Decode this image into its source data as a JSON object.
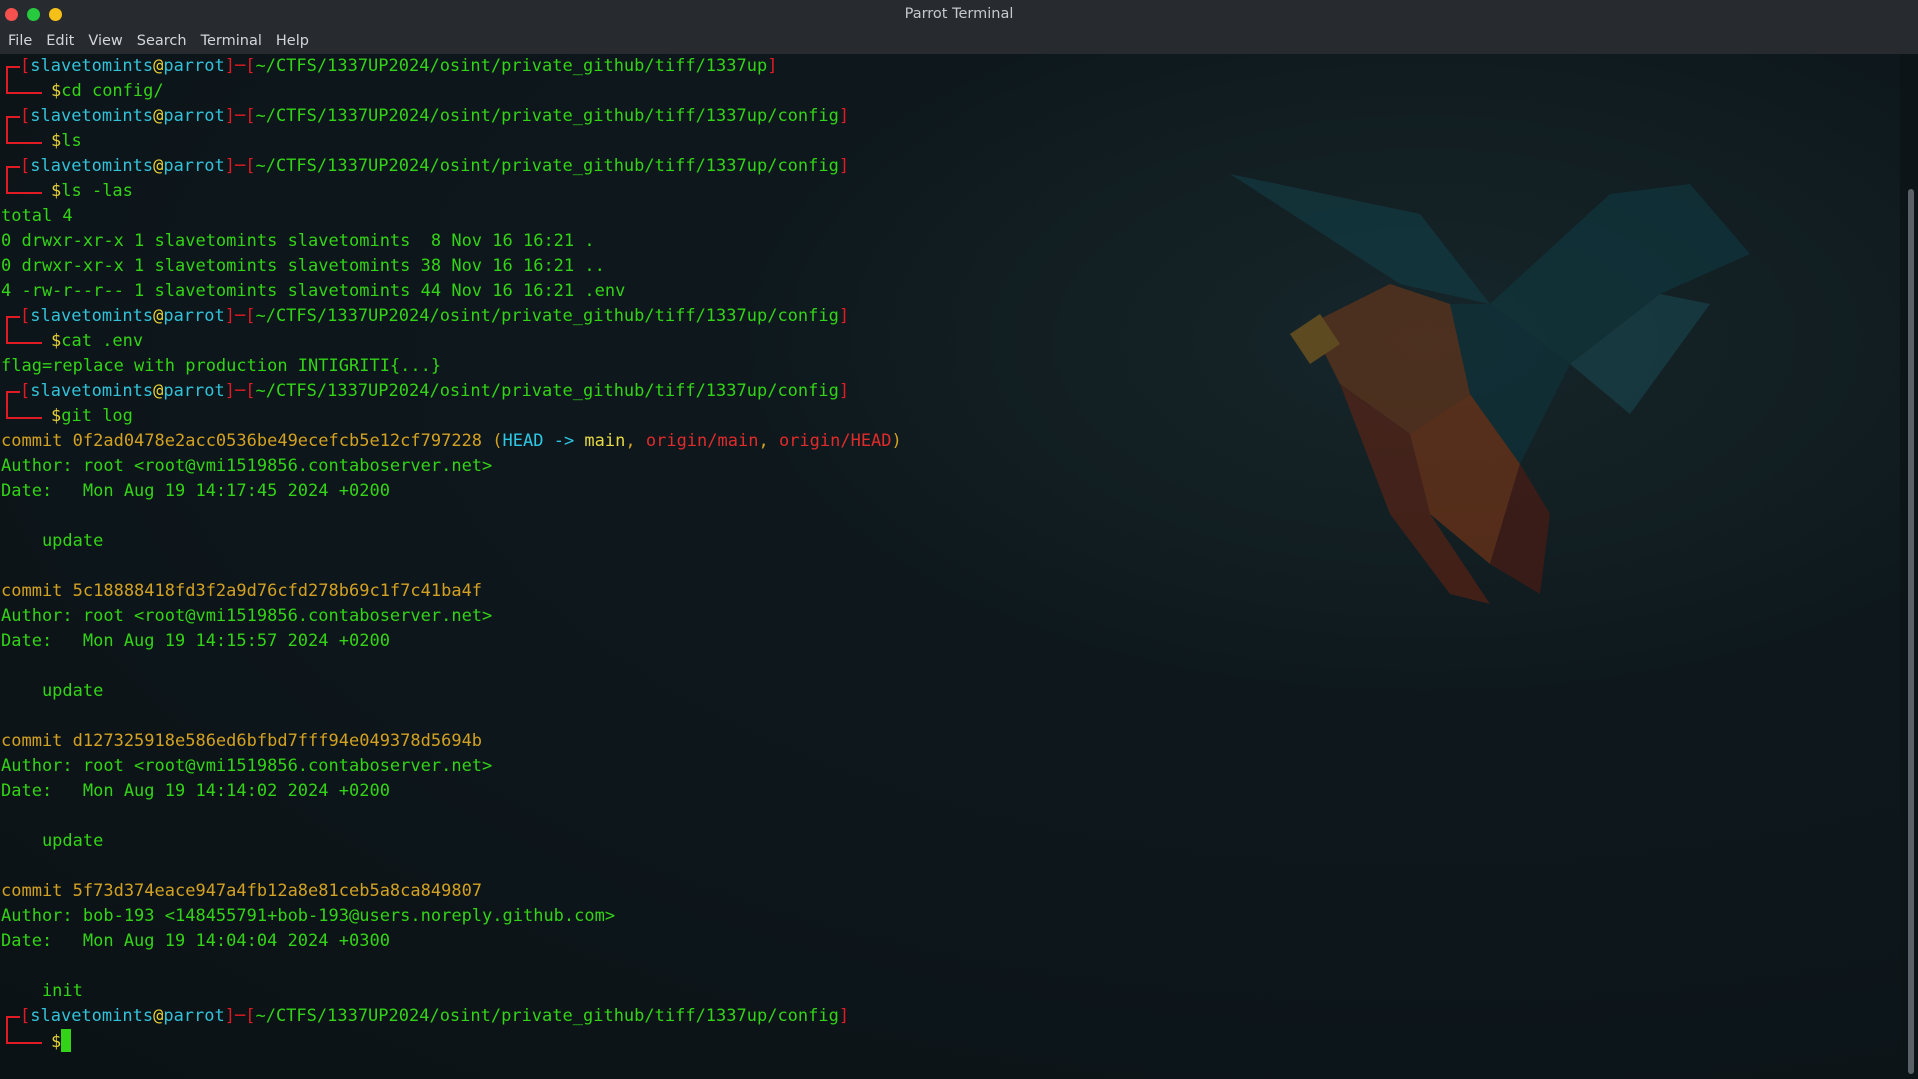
{
  "window": {
    "title": "Parrot Terminal"
  },
  "menu": [
    "File",
    "Edit",
    "View",
    "Search",
    "Terminal",
    "Help"
  ],
  "prompt": {
    "user": "slavetomints",
    "at": "@",
    "host": "parrot",
    "sep": "]─[",
    "open": "[",
    "close": "]",
    "dash": "─"
  },
  "blocks": [
    {
      "cwd": "~/CTFS/1337UP2024/osint/private_github/tiff/1337up",
      "cmd": "cd config/",
      "output": []
    },
    {
      "cwd": "~/CTFS/1337UP2024/osint/private_github/tiff/1337up/config",
      "cmd": "ls",
      "output": []
    },
    {
      "cwd": "~/CTFS/1337UP2024/osint/private_github/tiff/1337up/config",
      "cmd": "ls -las",
      "output": [
        "total 4",
        "0 drwxr-xr-x 1 slavetomints slavetomints  8 Nov 16 16:21 .",
        "0 drwxr-xr-x 1 slavetomints slavetomints 38 Nov 16 16:21 ..",
        "4 -rw-r--r-- 1 slavetomints slavetomints 44 Nov 16 16:21 .env"
      ]
    },
    {
      "cwd": "~/CTFS/1337UP2024/osint/private_github/tiff/1337up/config",
      "cmd": "cat .env",
      "output": [
        "flag=replace with production INTIGRITI{...}"
      ]
    },
    {
      "cwd": "~/CTFS/1337UP2024/osint/private_github/tiff/1337up/config",
      "cmd": "git log",
      "output": []
    }
  ],
  "git_log": {
    "head_refs": {
      "open": " (",
      "head": "HEAD -> ",
      "main": "main",
      "comma1": ", ",
      "origin_main": "origin/main",
      "comma2": ", ",
      "origin_head": "origin/HEAD",
      "close": ")"
    },
    "commits": [
      {
        "commit": "commit 0f2ad0478e2acc0536be49ecefcb5e12cf797228",
        "author": "Author: root <root@vmi1519856.contaboserver.net>",
        "date": "Date:   Mon Aug 19 14:17:45 2024 +0200",
        "msg": "    update"
      },
      {
        "commit": "commit 5c18888418fd3f2a9d76cfd278b69c1f7c41ba4f",
        "author": "Author: root <root@vmi1519856.contaboserver.net>",
        "date": "Date:   Mon Aug 19 14:15:57 2024 +0200",
        "msg": "    update"
      },
      {
        "commit": "commit d127325918e586ed6bfbd7fff94e049378d5694b",
        "author": "Author: root <root@vmi1519856.contaboserver.net>",
        "date": "Date:   Mon Aug 19 14:14:02 2024 +0200",
        "msg": "    update"
      },
      {
        "commit": "commit 5f73d374eace947a4fb12a8e81ceb5a8ca849807",
        "author": "Author: bob-193 <148455791+bob-193@users.noreply.github.com>",
        "date": "Date:   Mon Aug 19 14:04:04 2024 +0300",
        "msg": "    init"
      }
    ]
  },
  "final": {
    "cwd": "~/CTFS/1337UP2024/osint/private_github/tiff/1337up/config",
    "cmd": ""
  },
  "prompt_char": "$",
  "colors": {
    "prompt_red": "#e01b24",
    "user_cyan": "#32c2d9",
    "host_yellow": "#e8d338",
    "text_green": "#33d317",
    "commit_amber": "#d2a123",
    "bg": "#0d1418"
  },
  "icons": {
    "wallpaper": "parrot-logo-icon"
  }
}
